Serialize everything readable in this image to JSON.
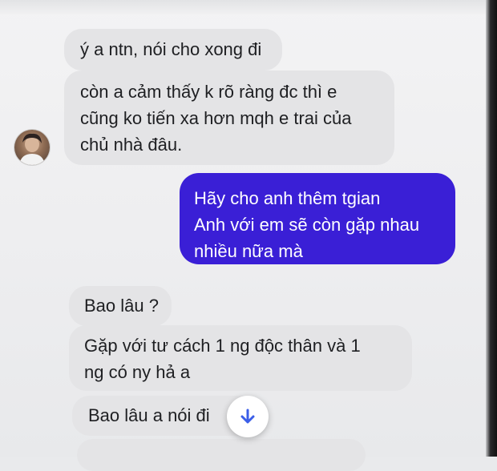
{
  "chat": {
    "messages": [
      {
        "direction": "incoming",
        "lines": [
          "ý a ntn, nói cho xong đi"
        ]
      },
      {
        "direction": "incoming",
        "lines": [
          "còn a cảm thấy k rõ ràng đc thì e",
          "cũng ko tiến xa hơn mqh e trai của",
          "chủ nhà đâu."
        ]
      },
      {
        "direction": "outgoing",
        "lines": [
          "Hãy cho anh thêm tgian",
          "Anh với em sẽ còn gặp nhau",
          "nhiều nữa mà"
        ]
      },
      {
        "direction": "incoming",
        "lines": [
          "Bao lâu ?"
        ]
      },
      {
        "direction": "incoming",
        "lines": [
          "Gặp với tư cách 1 ng độc thân và 1",
          "ng có ny hả a"
        ]
      },
      {
        "direction": "incoming",
        "lines": [
          "Bao lâu a nói đi"
        ]
      }
    ],
    "avatar_icon": "contact-avatar-photo",
    "scroll_down_icon": "arrow-down-icon",
    "colors": {
      "incoming_bubble": "#e4e4e6",
      "outgoing_bubble": "#3a1fd6",
      "scroll_arrow": "#3b5ee8"
    }
  }
}
